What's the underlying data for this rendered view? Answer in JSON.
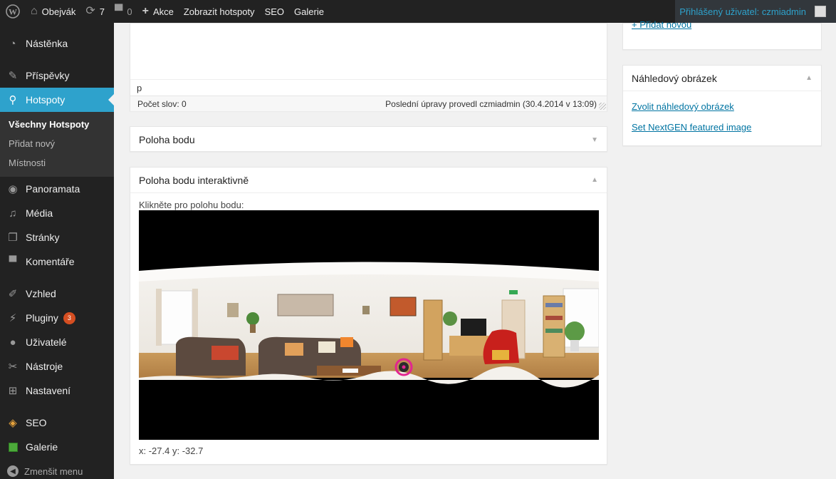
{
  "adminbar": {
    "site": "Obejvák",
    "updates": "7",
    "comments": "0",
    "new": "Akce",
    "links": [
      "Zobrazit hotspoty",
      "SEO",
      "Galerie"
    ],
    "user": "Přihlášený uživatel: czmiadmin"
  },
  "sidebar": {
    "items": [
      {
        "label": "Nástěnka",
        "icon": "dashboard-icon"
      },
      {
        "label": "Příspěvky",
        "icon": "pin-icon"
      },
      {
        "label": "Hotspoty",
        "icon": "location-pin-icon"
      },
      {
        "label": "Panoramata",
        "icon": "eye-icon"
      },
      {
        "label": "Média",
        "icon": "media-icon"
      },
      {
        "label": "Stránky",
        "icon": "pages-icon"
      },
      {
        "label": "Komentáře",
        "icon": "comment-icon"
      },
      {
        "label": "Vzhled",
        "icon": "brush-icon"
      },
      {
        "label": "Pluginy",
        "icon": "plugin-icon",
        "badge": "3"
      },
      {
        "label": "Uživatelé",
        "icon": "user-icon"
      },
      {
        "label": "Nástroje",
        "icon": "wrench-icon"
      },
      {
        "label": "Nastavení",
        "icon": "settings-icon"
      },
      {
        "label": "SEO",
        "icon": "seo-icon"
      },
      {
        "label": "Galerie",
        "icon": "gallery-icon"
      }
    ],
    "submenu": [
      "Všechny Hotspoty",
      "Přidat nový",
      "Místnosti"
    ],
    "collapse": "Zmenšit menu"
  },
  "editor": {
    "path": "p",
    "word_count": "Počet slov: 0",
    "last_edit": "Poslední úpravy provedl czmiadmin (30.4.2014 v 13:09)"
  },
  "poloha": {
    "title": "Poloha bodu"
  },
  "interakt": {
    "title": "Poloha bodu interaktivně",
    "instruction": "Klikněte pro polohu bodu:",
    "coords": "x: -27.4  y: -32.7"
  },
  "side": {
    "add_link": "+ Přidat novou",
    "thumb_title": "Náhledový obrázek",
    "thumb_links": [
      "Zvolit náhledový obrázek",
      "Set NextGEN featured image"
    ]
  },
  "colors": {
    "accent": "#2ea2cc",
    "link": "#0074a2",
    "marker": "#e2268f"
  }
}
